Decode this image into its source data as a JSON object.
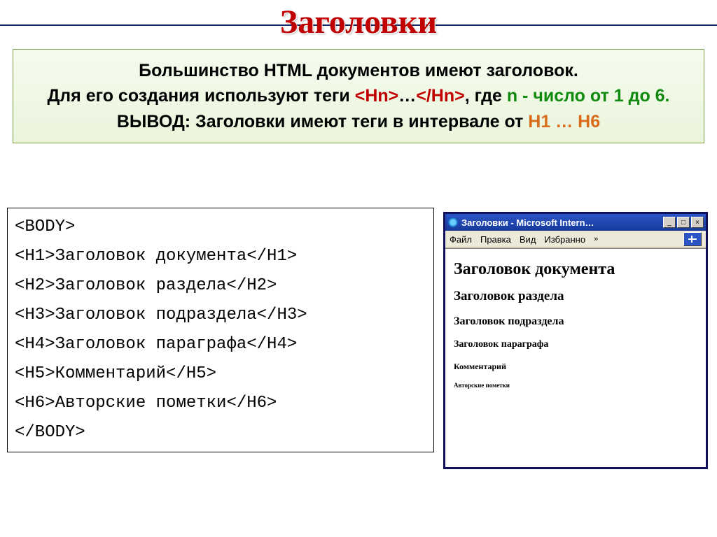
{
  "title": "Заголовки",
  "explain": {
    "line1a": "Большинство HTML документов имеют заголовок.",
    "line2a": "Для его создания используют теги ",
    "tag_open": "<Hn>",
    "tag_mid": "…",
    "tag_close": "</Hn>",
    "line2b": ", где ",
    "letter_n": "n",
    "line2c": " - число от 1 до 6.",
    "line3a": "ВЫВОД",
    "line3b": ": Заголовки имеют теги в интервале от ",
    "interval": "H1 … H6"
  },
  "code": {
    "l1": "<BODY>",
    "l2": "<H1>Заголовок документа</H1>",
    "l3": "<H2>Заголовок раздела</H2>",
    "l4": "<H3>Заголовок подраздела</H3>",
    "l5": "<H4>Заголовок параграфа</H4>",
    "l6": "<H5>Комментарий</H5>",
    "l7": "<H6>Авторские пометки</H6>",
    "l8": "</BODY>"
  },
  "browser": {
    "title": "Заголовки - Microsoft Intern…",
    "btn_min": "_",
    "btn_max": "□",
    "btn_close": "×",
    "menu": {
      "file": "Файл",
      "edit": "Правка",
      "view": "Вид",
      "fav": "Избранно",
      "chev": "»"
    },
    "content": {
      "h1": "Заголовок документа",
      "h2": "Заголовок раздела",
      "h3": "Заголовок подраздела",
      "h4": "Заголовок параграфа",
      "h5": "Комментарий",
      "h6": "Авторские пометки"
    }
  }
}
